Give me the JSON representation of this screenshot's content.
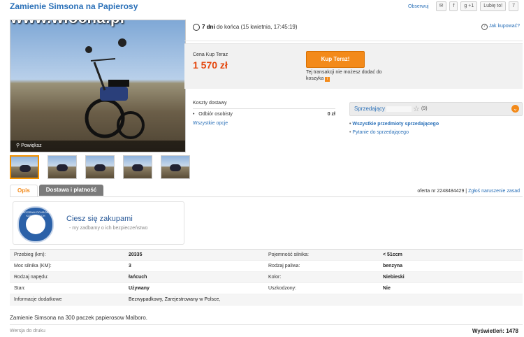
{
  "header": {
    "title": "Zamienie Simsona na Papierosy",
    "watermark": "www.wiocha.pl",
    "observe": "Obserwuj",
    "mail": "✉",
    "fb": "f",
    "gplus": "g +1",
    "like": "Lubię to!",
    "like_count": "7"
  },
  "gallery": {
    "enlarge": "Powiększ",
    "thumbs": 5
  },
  "auction": {
    "time_left_bold": "7 dni",
    "time_left_rest": " do końca (15 kwietnia, 17:45:19)",
    "how_to_buy": "Jak kupować?",
    "price_label": "Cena Kup Teraz",
    "price": "1 570 zł",
    "buy_button": "Kup Teraz!",
    "buy_note": "Tej transakcji nie możesz dodać do koszyka"
  },
  "shipping": {
    "title": "Koszty dostawy",
    "rows": [
      {
        "name": "Odbiór osobisty",
        "price": "0 zł"
      }
    ],
    "all_options": "Wszystkie opcje"
  },
  "seller": {
    "label": "Sprzedający",
    "rating": "(9)",
    "links": [
      "Wszystkie przedmioty sprzedającego",
      "Pytanie do sprzedającego"
    ]
  },
  "tabs": [
    {
      "label": "Opis",
      "active": true
    },
    {
      "label": "Dostawa i płatność",
      "active": false
    }
  ],
  "offer": {
    "number": "oferta nr 2248484429",
    "report": "Zgłoś naruszenie zasad"
  },
  "protection": {
    "heading": "Ciesz się zakupami",
    "sub": "- my zadbamy o ich bezpieczeństwo",
    "badge_text": "PROGRAM OCHRONY KUPUJĄCYCH"
  },
  "specs": [
    [
      "Przebieg (km):",
      "20335",
      "Pojemność silnika:",
      "< 51ccm"
    ],
    [
      "Moc silnika (KM):",
      "3",
      "Rodzaj paliwa:",
      "benzyna"
    ],
    [
      "Rodzaj napędu:",
      "łańcuch",
      "Kolor:",
      "Niebieski"
    ],
    [
      "Stan:",
      "Używany",
      "Uszkodzony:",
      "Nie"
    ],
    [
      "Informacje dodatkowe",
      "Bezwypadkowy, Zarejestrowany w Polsce,",
      "",
      ""
    ]
  ],
  "description": "Zamienie Simsona na 300 paczek papierosow Malboro.",
  "footer": {
    "print": "Wersja do druku",
    "views_label": "Wyświetleń:",
    "views": "1478"
  }
}
